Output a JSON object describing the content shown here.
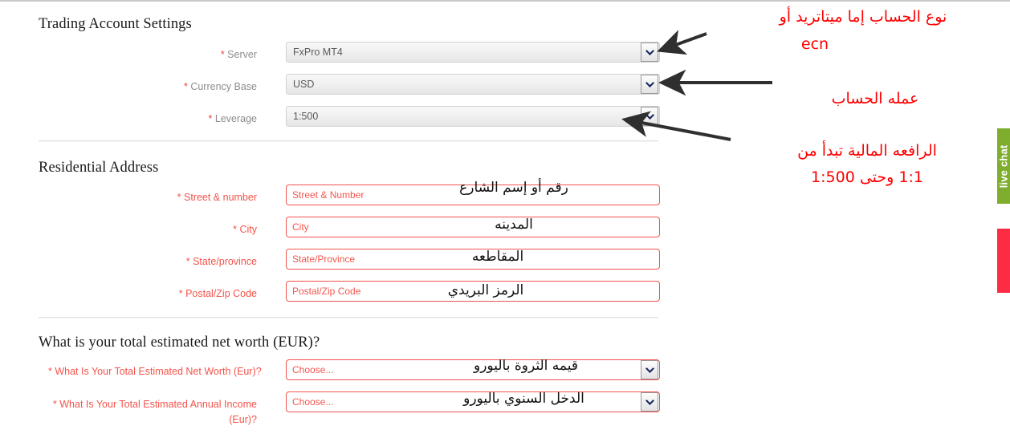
{
  "sections": [
    {
      "title": "Trading Account Settings"
    },
    {
      "title": "Residential Address"
    },
    {
      "title": "What is your total estimated net worth (EUR)?"
    }
  ],
  "trading_account": {
    "heading": "Trading Account Settings",
    "fields": [
      {
        "star": "*",
        "label": "Server",
        "value": "FxPro MT4"
      },
      {
        "star": "*",
        "label": "Currency Base",
        "value": "USD"
      },
      {
        "star": "*",
        "label": "Leverage",
        "value": "1:500"
      }
    ]
  },
  "residential_address": {
    "heading": "Residential Address",
    "fields": [
      {
        "star": "*",
        "label": "Street & number",
        "placeholder": "Street & Number",
        "value": ""
      },
      {
        "star": "*",
        "label": "City",
        "placeholder": "City",
        "value": ""
      },
      {
        "star": "*",
        "label": "State/province",
        "placeholder": "State/Province",
        "value": ""
      },
      {
        "star": "*",
        "label": "Postal/Zip Code",
        "placeholder": "Postal/Zip Code",
        "value": ""
      }
    ]
  },
  "net_worth": {
    "heading": "What is your total estimated net worth (EUR)?",
    "fields": [
      {
        "star": "*",
        "label": "What Is Your Total Estimated Net Worth (Eur)?",
        "value": "Choose..."
      },
      {
        "star": "*",
        "label": "What Is Your Total Estimated Annual Income (Eur)?",
        "value": "Choose..."
      }
    ]
  },
  "annotations": {
    "account_type_line1": "نوع الحساب إما ميتاتريد أو",
    "account_type_line2": "ecn",
    "currency": "عمله الحساب",
    "leverage_line1": "الرافعه المالية تبدأ من",
    "leverage_line2": "1:1 وحتى 1:500",
    "street": "رقم أو إسم الشارع",
    "city": "المدينه",
    "state": "المقاطعه",
    "postal": "الرمز البريدي",
    "net_worth": "قيمه الثروة باليورو",
    "annual_income": "الدخل السنوي باليورو"
  },
  "side_tabs": {
    "live_chat": "live chat",
    "callback": ""
  },
  "colors": {
    "annotation_red": "#fe0000",
    "error_red": "#f4564d",
    "label_gray": "#8c8c8c",
    "live_chat_green": "#7fae2f",
    "callback_red": "#fb2c44"
  }
}
